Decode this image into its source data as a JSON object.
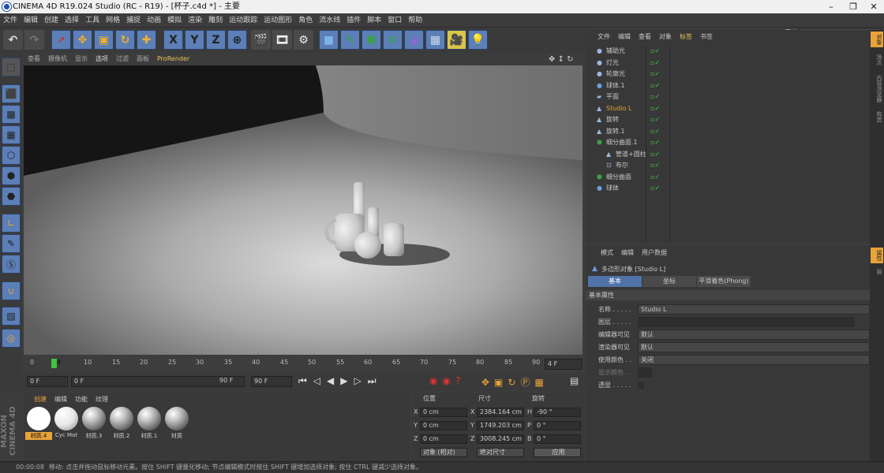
{
  "window": {
    "title": "CINEMA 4D R19.024 Studio (RC - R19) - [杯子.c4d *] - 主要",
    "minimize": "–",
    "maximize": "❐",
    "close": "✕"
  },
  "menu": [
    "文件",
    "编辑",
    "创建",
    "选择",
    "工具",
    "网格",
    "捕捉",
    "动画",
    "模拟",
    "渲染",
    "雕刻",
    "运动跟踪",
    "运动图形",
    "角色",
    "流水线",
    "插件",
    "脚本",
    "窗口",
    "帮助"
  ],
  "interface": {
    "label": "界面:",
    "value": "启动"
  },
  "toolbar": {
    "icons": [
      "undo-icon",
      "redo-icon",
      "select-icon",
      "move-icon",
      "scale-icon",
      "rotate-icon",
      "recent-tool-icon",
      "x-axis-icon",
      "y-axis-icon",
      "z-axis-icon",
      "coordinate-system-icon",
      "render-view-icon",
      "render-picture-viewer-icon",
      "render-settings-icon",
      "cube-icon",
      "pen-icon",
      "subdivision-icon",
      "array-icon",
      "deformer-icon",
      "floor-icon",
      "camera-icon",
      "light-icon"
    ],
    "axis_labels": [
      "X",
      "Y",
      "Z"
    ]
  },
  "left_tools": [
    "make-editable-icon",
    "model-mode-icon",
    "texture-mode-icon",
    "workplane-icon",
    "points-mode-icon",
    "edges-mode-icon",
    "polygons-mode-icon",
    "axis-mode-icon",
    "brush-icon",
    "snap-icon",
    "magnet-icon",
    "lock-icon",
    "soft-select-icon"
  ],
  "viewport": {
    "menu": [
      "查看",
      "摄像机",
      "显示",
      "选项",
      "过滤",
      "面板",
      "ProRender"
    ]
  },
  "timeline": {
    "ticks": [
      "0",
      "4",
      "10",
      "15",
      "20",
      "25",
      "30",
      "35",
      "40",
      "45",
      "50",
      "55",
      "60",
      "65",
      "70",
      "75",
      "80",
      "85",
      "90"
    ],
    "current": "4 F",
    "start": "0 F",
    "min": "0 F",
    "max": "90 F",
    "end": "90 F"
  },
  "materials": {
    "menu": [
      "创建",
      "编辑",
      "功能",
      "纹理"
    ],
    "items": [
      {
        "label": "材质.4",
        "selected": true,
        "white": true
      },
      {
        "label": "Cyc Mat",
        "selected": false,
        "white": true
      },
      {
        "label": "材质.3",
        "selected": false,
        "white": false
      },
      {
        "label": "材质.2",
        "selected": false,
        "white": false
      },
      {
        "label": "材质.1",
        "selected": false,
        "white": false
      },
      {
        "label": "材质",
        "selected": false,
        "white": false
      }
    ]
  },
  "coords": {
    "headers": [
      "位置",
      "尺寸",
      "旋转"
    ],
    "pos": [
      {
        "axis": "X",
        "val": "0 cm"
      },
      {
        "axis": "Y",
        "val": "0 cm"
      },
      {
        "axis": "Z",
        "val": "0 cm"
      }
    ],
    "size": [
      {
        "axis": "X",
        "val": "2384.164 cm"
      },
      {
        "axis": "Y",
        "val": "1749.203 cm"
      },
      {
        "axis": "Z",
        "val": "3008.245 cm"
      }
    ],
    "rot": [
      {
        "axis": "H",
        "val": "-90 °"
      },
      {
        "axis": "P",
        "val": "0 °"
      },
      {
        "axis": "B",
        "val": "0 °"
      }
    ],
    "mode": "对象 (相对)",
    "sizemode": "绝对尺寸",
    "apply": "应用"
  },
  "objects": {
    "menu": [
      "文件",
      "编辑",
      "查看",
      "对象",
      "标签",
      "书签"
    ],
    "items": [
      {
        "name": "辅助光",
        "indent": 0,
        "icon": "light-icon",
        "selected": false
      },
      {
        "name": "灯光",
        "indent": 0,
        "icon": "light-icon",
        "selected": false
      },
      {
        "name": "轮廓光",
        "indent": 0,
        "icon": "light-icon",
        "selected": false
      },
      {
        "name": "球体.1",
        "indent": 0,
        "icon": "sphere-icon",
        "selected": false
      },
      {
        "name": "平面",
        "indent": 0,
        "icon": "plane-icon",
        "selected": false
      },
      {
        "name": "Studio L",
        "indent": 0,
        "icon": "polygon-icon",
        "selected": true
      },
      {
        "name": "旋转",
        "indent": 0,
        "icon": "polygon-icon",
        "selected": false
      },
      {
        "name": "旋转.1",
        "indent": 0,
        "icon": "polygon-icon",
        "selected": false
      },
      {
        "name": "细分曲面.1",
        "indent": 0,
        "icon": "subdivision-icon",
        "selected": false
      },
      {
        "name": "管道+圆柱",
        "indent": 1,
        "icon": "polygon-icon",
        "selected": false
      },
      {
        "name": "布尔",
        "indent": 1,
        "icon": "boole-icon",
        "selected": false
      },
      {
        "name": "细分曲面",
        "indent": 0,
        "icon": "subdivision-icon",
        "selected": false
      },
      {
        "name": "球体",
        "indent": 0,
        "icon": "sphere-icon",
        "selected": false
      }
    ]
  },
  "attributes": {
    "menu": [
      "模式",
      "编辑",
      "用户数据"
    ],
    "title": "多边形对象 [Studio L]",
    "tabs": [
      "基本",
      "坐标",
      "平滑着色(Phong)"
    ],
    "section": "基本属性",
    "rows": [
      {
        "label": "名称 . . . . .",
        "value": "Studio L"
      },
      {
        "label": "图层 . . . . .",
        "value": ""
      },
      {
        "label": "编辑器可见",
        "value": "默认"
      },
      {
        "label": "渲染器可见",
        "value": "默认"
      },
      {
        "label": "使用颜色 . .",
        "value": "关闭"
      },
      {
        "label": "显示颜色 . .",
        "value": ""
      },
      {
        "label": "透显 . . . . .",
        "value": ""
      }
    ]
  },
  "right_tabs": [
    "对象",
    "场次",
    "内容浏览器",
    "构造",
    "属性",
    "层"
  ],
  "status": {
    "time": "00:00:08",
    "message": "移动: 点击并拖动鼠标移动元素。按住 SHIFT 键量化移动; 节点编辑模式时按住 SHIFT 键增加选择对象; 按住 CTRL 键减少选择对象。"
  },
  "branding": {
    "logo": "MAXON CINEMA 4D"
  },
  "colors": {
    "accent": "#e8a33a",
    "selection": "#5b7fb6",
    "tab_active": "#4f72a8"
  }
}
